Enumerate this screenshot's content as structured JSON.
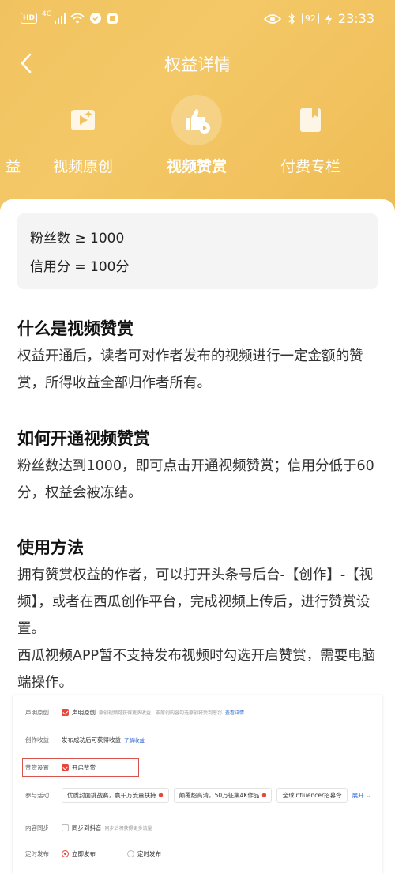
{
  "status_bar": {
    "left_badge": "HD",
    "network": "4G",
    "battery": "92",
    "time": "23:33"
  },
  "nav": {
    "title": "权益详情",
    "back_icon": "chevron-left-icon"
  },
  "tabs": [
    {
      "label": "益",
      "icon": "none",
      "active": false
    },
    {
      "label": "视频原创",
      "icon": "video-original-icon",
      "active": false
    },
    {
      "label": "视频赞赏",
      "icon": "thumbs-up-play-icon",
      "active": true
    },
    {
      "label": "付费专栏",
      "icon": "bookmark-icon",
      "active": false
    }
  ],
  "requirements": {
    "fans": "粉丝数 ≥ 1000",
    "credit": "信用分 = 100分"
  },
  "sections": [
    {
      "title": "什么是视频赞赏",
      "body": "权益开通后，读者可对作者发布的视频进行一定金额的赞赏，所得收益全部归作者所有。"
    },
    {
      "title": "如何开通视频赞赏",
      "body": "粉丝数达到1000，即可点击开通视频赞赏；信用分低于60分，权益会被冻结。"
    },
    {
      "title": "使用方法",
      "body": "拥有赞赏权益的作者，可以打开头条号后台-【创作】-【视频】，或者在西瓜创作平台，完成视频上传后，进行赞赏设置。",
      "body2": "西瓜视频APP暂不支持发布视频时勾选开启赞赏，需要电脑端操作。"
    }
  ],
  "screenshot": {
    "rows": [
      {
        "label": "声明原创",
        "check_label": "声明原创",
        "hint": "原创视频可获得更多收益，非原创内容勾选原创将受到惩罚",
        "link": "查看详情"
      },
      {
        "label": "创作收益",
        "text": "发布成功后可获得收益",
        "link": "了解收益"
      },
      {
        "label": "赞赏设置",
        "check_label": "开启赞赏"
      },
      {
        "label": "参与活动",
        "chips": [
          "优质封面挑战赛，赢千万流量扶持",
          "颠覆超高清，50万征集4K作品",
          "全球Influencer招募令"
        ],
        "expand": "展开"
      },
      {
        "label": "内容同步",
        "check_label": "同步到抖音",
        "hint": "同步后将获得更多流量"
      },
      {
        "label": "定时发布",
        "radio1": "立即发布",
        "radio2": "定时发布"
      }
    ]
  },
  "colors": {
    "header": "#f3c360",
    "accent_red": "#e8453c",
    "link_blue": "#2f6bd6"
  }
}
